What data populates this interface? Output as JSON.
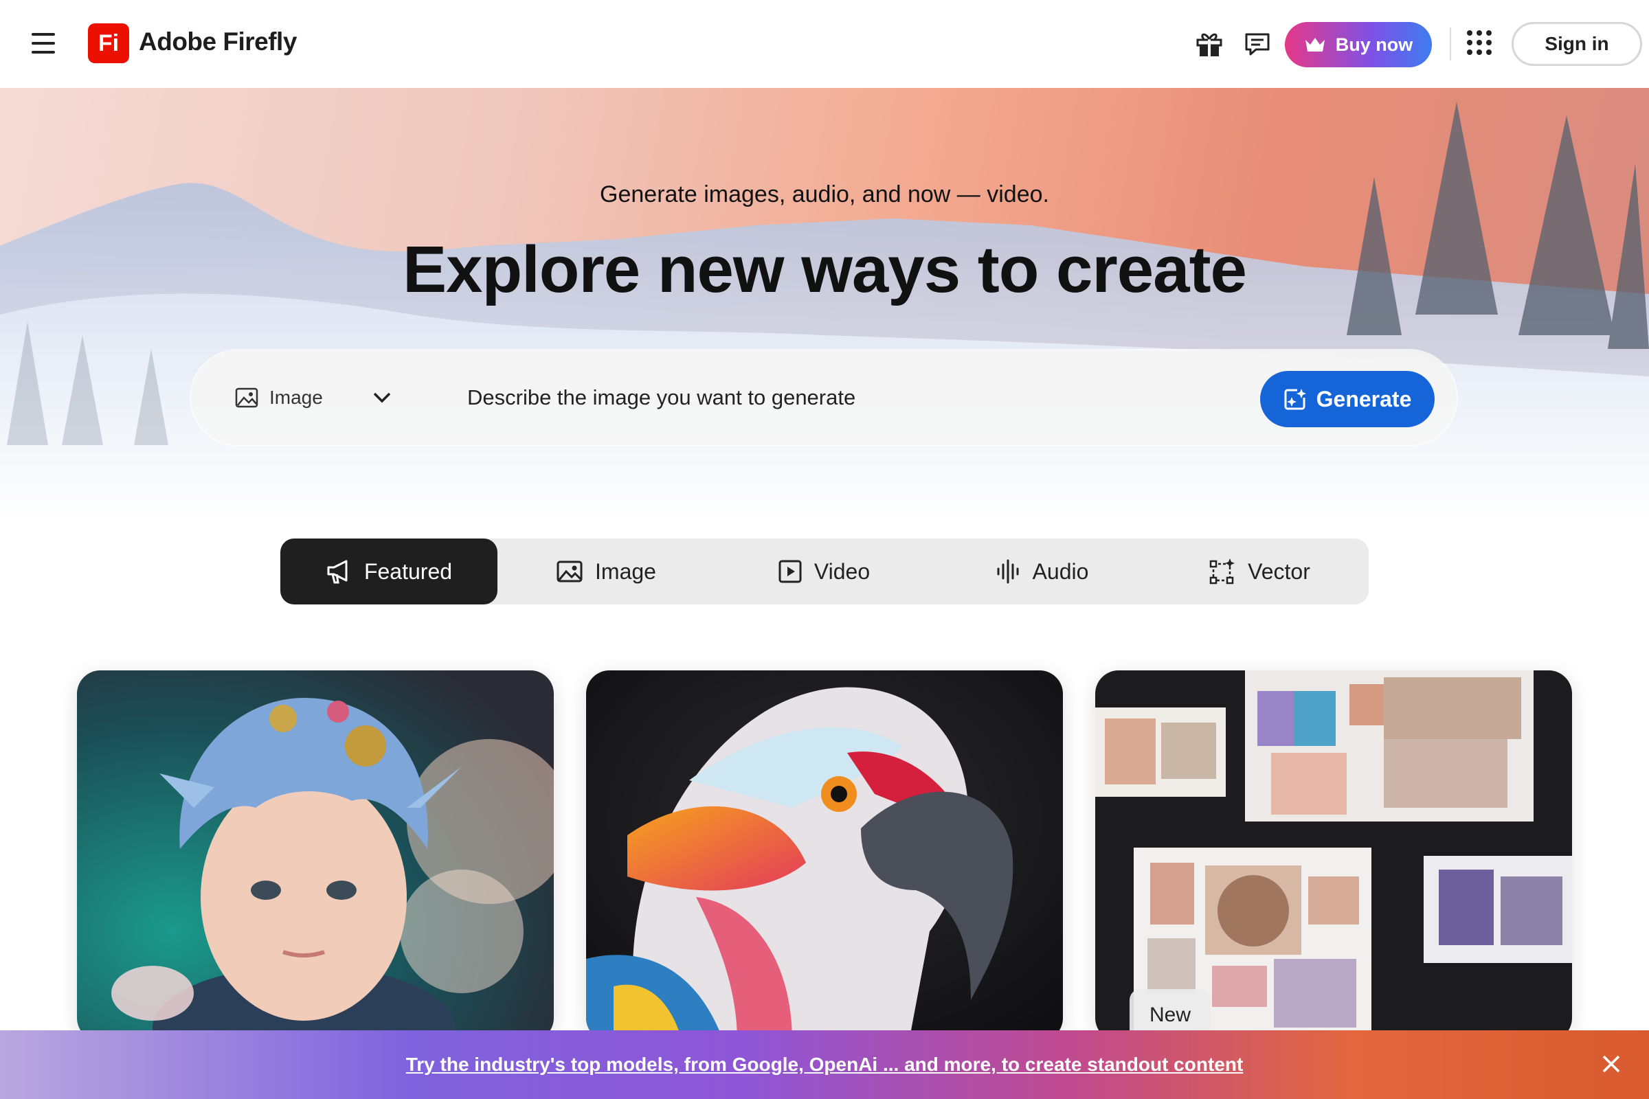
{
  "header": {
    "menu_icon": "hamburger-icon",
    "logo_text": "Fi",
    "brand": "Adobe Firefly",
    "gift_icon": "gift-icon",
    "feedback_icon": "chat-icon",
    "buy_label": "Buy now",
    "apps_icon": "app-grid-icon",
    "signin_label": "Sign in"
  },
  "hero": {
    "subtitle": "Generate images, audio, and now — video.",
    "title": "Explore new ways to create",
    "type_selected": "Image",
    "prompt_placeholder": "Describe the image you want to generate",
    "generate_label": "Generate"
  },
  "tabs": [
    {
      "label": "Featured",
      "icon": "megaphone-icon",
      "active": true
    },
    {
      "label": "Image",
      "icon": "image-icon"
    },
    {
      "label": "Video",
      "icon": "play-icon"
    },
    {
      "label": "Audio",
      "icon": "audio-wave-icon"
    },
    {
      "label": "Vector",
      "icon": "vector-icon"
    }
  ],
  "cards": [
    {
      "subject": "blue-haired child portrait"
    },
    {
      "subject": "parrot close-up"
    },
    {
      "subject": "product moodboard",
      "badge": "New"
    }
  ],
  "banner": {
    "text": "Try the industry's top models, from Google, OpenAi ... and more, to create standout content",
    "close_icon": "close-icon"
  },
  "colors": {
    "accent": "#1565d8",
    "logo": "#eb1000",
    "active_tab": "#1f1f1f"
  }
}
